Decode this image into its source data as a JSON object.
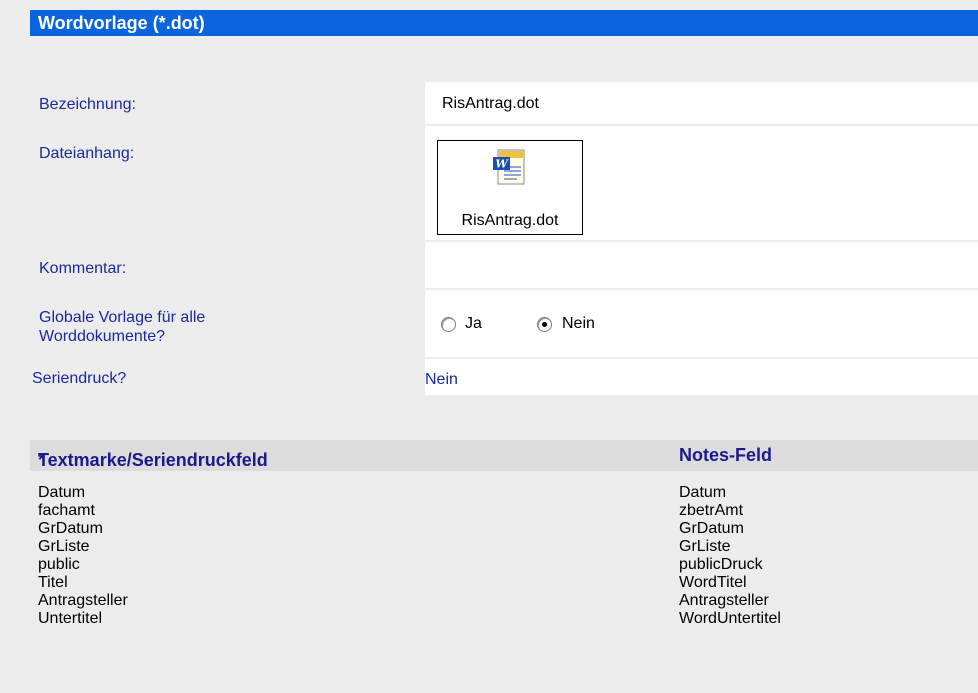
{
  "header": {
    "title": "Wordvorlage (*.dot)"
  },
  "form": {
    "bezeichnung": {
      "label": "Bezeichnung:",
      "value": "RisAntrag.dot"
    },
    "dateianhang": {
      "label": "Dateianhang:",
      "filename": "RisAntrag.dot",
      "icon": "word-document-icon"
    },
    "kommentar": {
      "label": "Kommentar:",
      "value": ""
    },
    "globale_vorlage": {
      "label_line1": "Globale Vorlage für alle",
      "label_line2": "Worddokumente?",
      "options": [
        "Ja",
        "Nein"
      ],
      "selected": "Nein"
    },
    "seriendruck": {
      "label": "Seriendruck?",
      "value": "Nein"
    }
  },
  "mapping": {
    "col1_header": "Textmarke/Seriendruckfeld",
    "required_marker": "*",
    "col2_header": "Notes-Feld",
    "rows": [
      [
        "Datum",
        "Datum"
      ],
      [
        "fachamt",
        "zbetrAmt"
      ],
      [
        "GrDatum",
        "GrDatum"
      ],
      [
        "GrListe",
        "GrListe"
      ],
      [
        "public",
        "publicDruck"
      ],
      [
        "Titel",
        "WordTitel"
      ],
      [
        "Antragsteller",
        "Antragsteller"
      ],
      [
        "Untertitel",
        "WordUntertitel"
      ]
    ]
  },
  "colors": {
    "title_bar": "#0a64dc",
    "label_text": "#1a2a9a",
    "header_text": "#1a1a8c",
    "required": "#e00000"
  }
}
